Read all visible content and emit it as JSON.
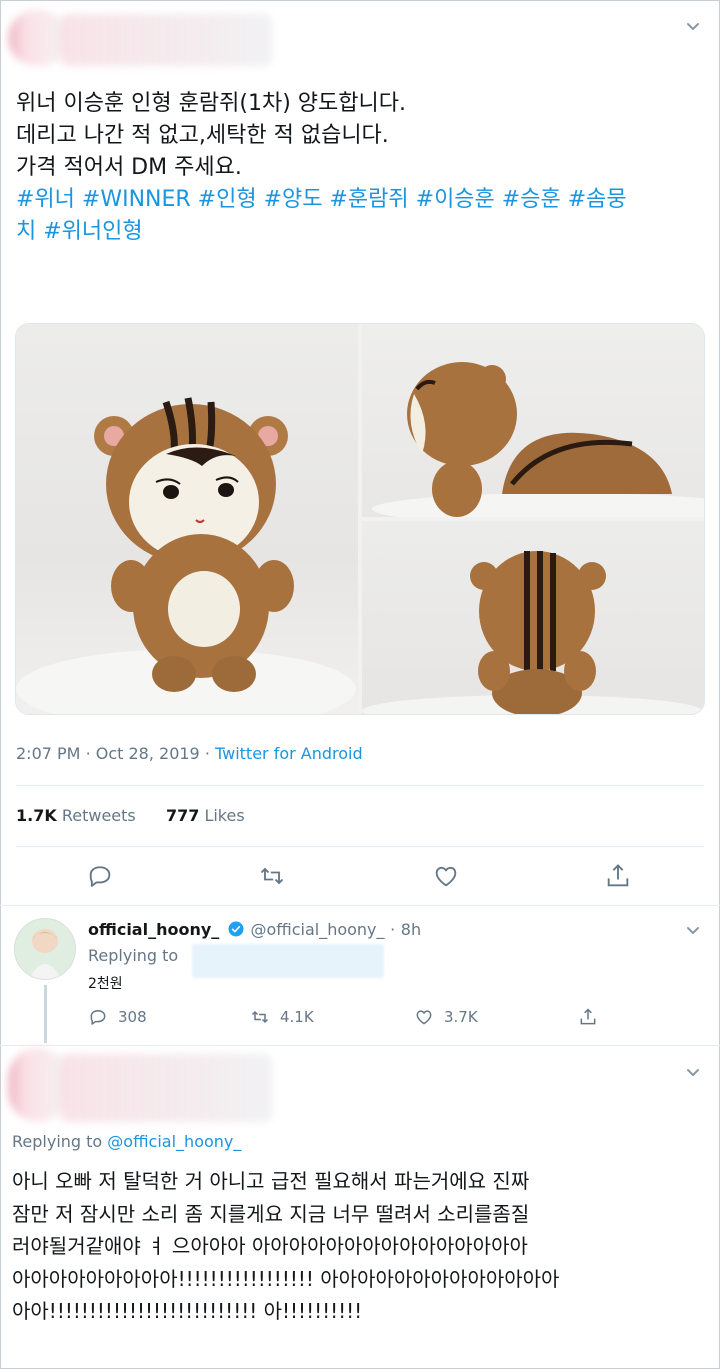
{
  "tweet": {
    "lines": [
      "위너 이승훈 인형 훈람쥐(1차) 양도합니다.",
      "데리고 나간 적 없고,세탁한 적 없습니다.",
      "가격 적어서 DM 주세요."
    ],
    "hashtags_line1": "#위너 #WINNER #인형 #양도 #훈람쥐 #이승훈 #승훈 #솜뭉",
    "hashtags_line2": "치  #위너인형",
    "time": "2:07 PM",
    "date": "Oct 28, 2019",
    "source": "Twitter for Android",
    "retweets_count": "1.7K",
    "retweets_label": "Retweets",
    "likes_count": "777",
    "likes_label": "Likes"
  },
  "reply": {
    "display_name": "official_hoony_",
    "handle": "@official_hoony_",
    "age": "8h",
    "replying_to_label": "Replying to",
    "text": "2천원",
    "replies": "308",
    "retweets": "4.1K",
    "likes": "3.7K"
  },
  "second_tweet": {
    "replying_to_label": "Replying to",
    "replying_to_handle": "@official_hoony_",
    "lines": [
      "아니 오빠 저 탈덕한 거 아니고 급전 필요해서 파는거에요 진짜",
      "잠만 저 잠시만 소리 좀 지를게요 지금 너무 떨려서 소리를좀질",
      "러야될거같애야 ㅕ  으아아아 아아아아아아아아아아아아아아아",
      "아아아아아아아아아!!!!!!!!!!!!!!!!! 아아아아아아아아아아아아아",
      "아아!!!!!!!!!!!!!!!!!!!!!!!!!! 아!!!!!!!!!!"
    ]
  },
  "icons": [
    "chevron-down-icon",
    "reply-icon",
    "retweet-icon",
    "like-icon",
    "share-icon",
    "verified-icon"
  ],
  "colors": {
    "link": "#1b95e0",
    "muted": "#657786",
    "text": "#14171a",
    "verified": "#1da1f2"
  }
}
